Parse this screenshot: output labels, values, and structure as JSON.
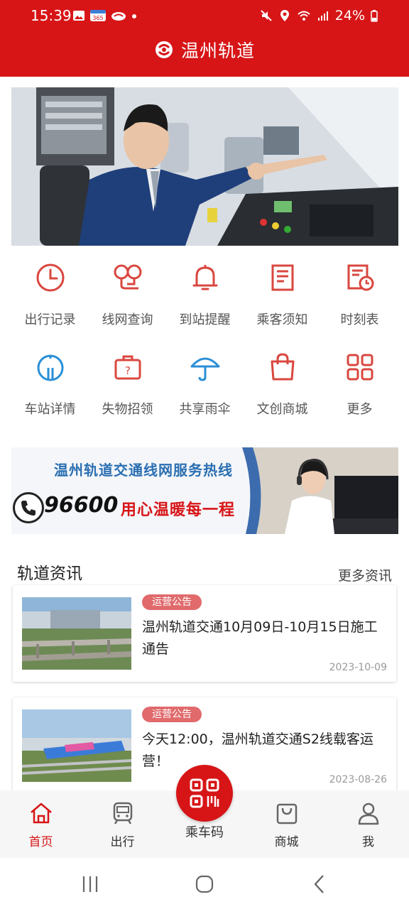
{
  "status_bar": {
    "time": "15:39",
    "battery": "24%",
    "calendar_badge": "365"
  },
  "header": {
    "title": "温州轨道"
  },
  "grid_menu": [
    {
      "label": "出行记录",
      "icon": "clock-icon"
    },
    {
      "label": "线网查询",
      "icon": "route-map-icon"
    },
    {
      "label": "到站提醒",
      "icon": "bell-icon"
    },
    {
      "label": "乘客须知",
      "icon": "notice-document-icon"
    },
    {
      "label": "时刻表",
      "icon": "timetable-icon"
    },
    {
      "label": "车站详情",
      "icon": "station-icon"
    },
    {
      "label": "失物招领",
      "icon": "lost-found-bag-icon"
    },
    {
      "label": "共享雨伞",
      "icon": "umbrella-icon"
    },
    {
      "label": "文创商城",
      "icon": "shopping-bag-icon"
    },
    {
      "label": "更多",
      "icon": "more-grid-icon"
    }
  ],
  "hotline_ad": {
    "headline": "温州轨道交通线网服务热线",
    "number": "96600",
    "slogan": "用心温暖每一程"
  },
  "news": {
    "section_title": "轨道资讯",
    "more_label": "更多资讯",
    "items": [
      {
        "tag": "运营公告",
        "title": "温州轨道交通10月09日-10月15日施工通告",
        "date": "2023-10-09"
      },
      {
        "tag": "运营公告",
        "title": "今天12:00，温州轨道交通S2线载客运营！",
        "date": "2023-08-26"
      }
    ]
  },
  "bottom_nav": {
    "items": [
      {
        "label": "首页",
        "icon": "home-icon",
        "active": true
      },
      {
        "label": "出行",
        "icon": "train-icon",
        "active": false
      },
      {
        "label": "商城",
        "icon": "shop-bag-icon",
        "active": false
      },
      {
        "label": "我",
        "icon": "user-icon",
        "active": false
      }
    ],
    "center_label": "乘车码",
    "center_icon": "qr-code-icon"
  },
  "colors": {
    "brand": "#d71517",
    "icon_red": "#d9473f",
    "icon_blue": "#2b8fd6",
    "tag": "#e06a6c"
  }
}
